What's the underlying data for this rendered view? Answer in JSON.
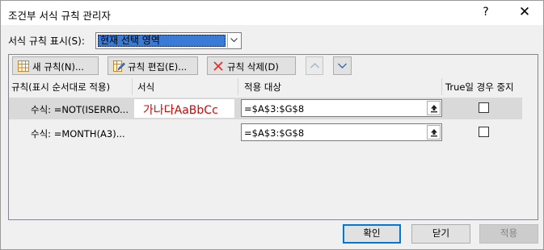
{
  "window": {
    "title": "조건부 서식 규칙 관리자",
    "help": "?",
    "close": "✕"
  },
  "show_rules": {
    "label": "서식 규칙 표시(S):",
    "selected": "현재 선택 영역"
  },
  "toolbar": {
    "new_rule": "새 규칙(N)...",
    "edit_rule": "규칙 편집(E)...",
    "delete_rule": "규칙 삭제(D)"
  },
  "columns": {
    "rule": "규칙(표시 순서대로 적용)",
    "format": "서식",
    "applies_to": "적용 대상",
    "stop_if_true": "True일 경우 중지"
  },
  "rules": [
    {
      "rule": "수식: =NOT(ISERRO...",
      "preview": "가나다AaBbCc",
      "applies_to": "=$A$3:$G$8",
      "stop_if_true": false,
      "selected": true
    },
    {
      "rule": "수식: =MONTH(A3)...",
      "preview": "",
      "applies_to": "=$A$3:$G$8",
      "stop_if_true": false,
      "selected": false
    }
  ],
  "footer": {
    "ok": "확인",
    "close": "닫기",
    "apply": "적용"
  },
  "colors": {
    "preview_text": "#e00000",
    "selection": "#3a7bd5",
    "default_button_border": "#0078d7"
  }
}
